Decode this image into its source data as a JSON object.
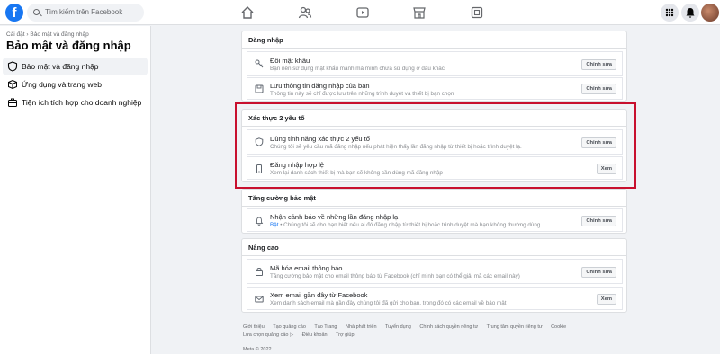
{
  "topbar": {
    "logo": "f",
    "search_placeholder": "Tìm kiếm trên Facebook"
  },
  "sidebar": {
    "breadcrumb": "Cài đặt › Bảo mật và đăng nhập",
    "title": "Bảo mật và đăng nhập",
    "items": [
      {
        "label": "Bảo mật và đăng nhập",
        "icon": "shield-icon"
      },
      {
        "label": "Ứng dụng và trang web",
        "icon": "box-icon"
      },
      {
        "label": "Tiện ích tích hợp cho doanh nghiệp",
        "icon": "briefcase-icon"
      }
    ]
  },
  "sections": {
    "login": {
      "title": "Đăng nhập",
      "rows": [
        {
          "title": "Đổi mật khẩu",
          "desc": "Bạn nên sử dụng mật khẩu mạnh mà mình chưa sử dụng ở đâu khác",
          "button": "Chỉnh sửa",
          "icon": "key-icon"
        },
        {
          "title": "Lưu thông tin đăng nhập của bạn",
          "desc": "Thông tin này sẽ chỉ được lưu trên những trình duyệt và thiết bị bạn chọn",
          "button": "Chỉnh sửa",
          "icon": "save-icon"
        }
      ]
    },
    "twofa": {
      "title": "Xác thực 2 yếu tố",
      "rows": [
        {
          "title": "Dùng tính năng xác thực 2 yếu tố",
          "desc": "Chúng tôi sẽ yêu cầu mã đăng nhập nếu phát hiện thấy lần đăng nhập từ thiết bị hoặc trình duyệt lạ.",
          "button": "Chỉnh sửa",
          "icon": "shield-icon"
        },
        {
          "title": "Đăng nhập hợp lệ",
          "desc": "Xem lại danh sách thiết bị mà bạn sẽ không cần dùng mã đăng nhập",
          "button": "Xem",
          "icon": "phone-icon"
        }
      ]
    },
    "extra": {
      "title": "Tăng cường bảo mật",
      "rows": [
        {
          "title": "Nhận cảnh báo về những lần đăng nhập lạ",
          "desc_prefix": "Bật",
          "desc": " • Chúng tôi sẽ cho bạn biết nếu ai đó đăng nhập từ thiết bị hoặc trình duyệt mà bạn không thường dùng",
          "button": "Chỉnh sửa",
          "icon": "bell-icon"
        }
      ]
    },
    "advanced": {
      "title": "Nâng cao",
      "rows": [
        {
          "title": "Mã hóa email thông báo",
          "desc": "Tăng cường bảo mật cho email thông báo từ Facebook (chỉ mình bạn có thể giải mã các email này)",
          "button": "Chỉnh sửa",
          "icon": "lock-icon"
        },
        {
          "title": "Xem email gần đây từ Facebook",
          "desc": "Xem danh sách email mà gần đây chúng tôi đã gửi cho bạn, trong đó có các email về bảo mật",
          "button": "Xem",
          "icon": "mail-icon"
        }
      ]
    }
  },
  "footer": {
    "links_1": [
      "Giới thiệu",
      "Tạo quảng cáo",
      "Tạo Trang",
      "Nhà phát triển",
      "Tuyển dụng",
      "Chính sách quyền riêng tư",
      "Trung tâm quyền riêng tư",
      "Cookie"
    ],
    "links_2": [
      "Lựa chọn quảng cáo ▷",
      "Điều khoản",
      "Trợ giúp"
    ],
    "copyright": "Meta © 2022"
  }
}
